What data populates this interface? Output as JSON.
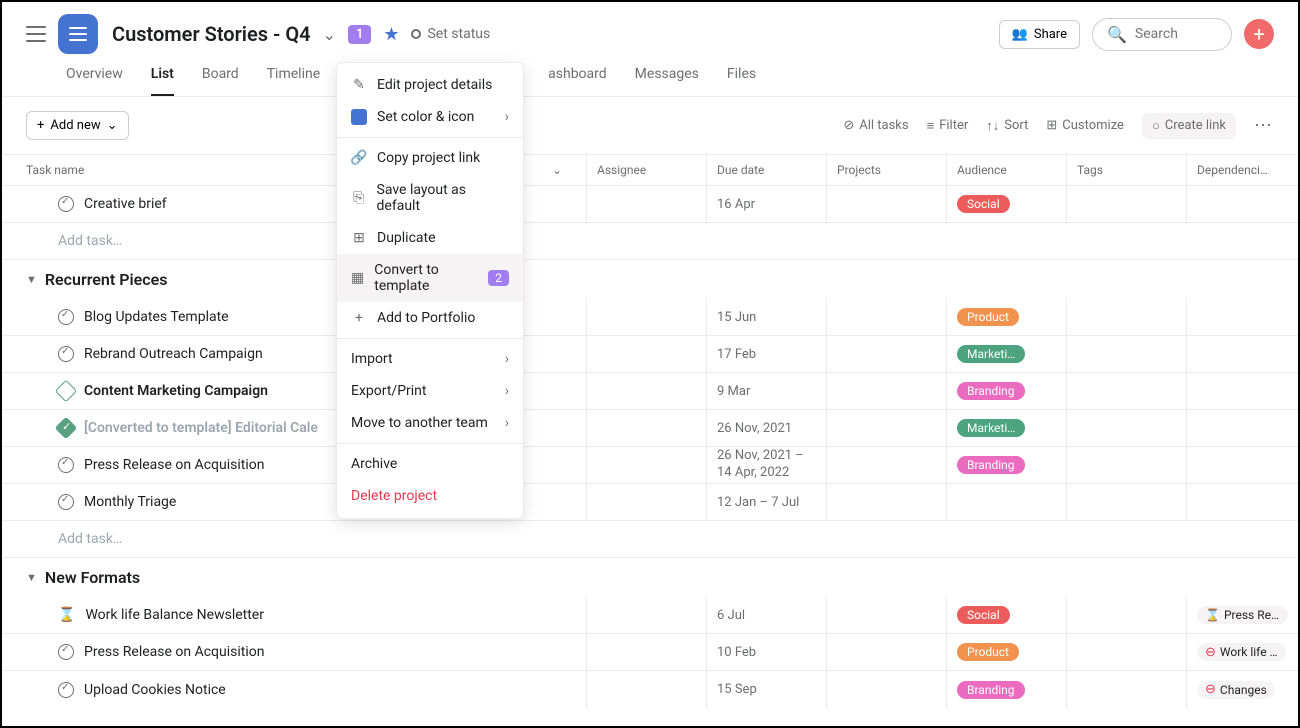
{
  "header": {
    "project_title": "Customer Stories - Q4",
    "badge": "1",
    "status_label": "Set status",
    "share_label": "Share",
    "search_placeholder": "Search"
  },
  "tabs": [
    "Overview",
    "List",
    "Board",
    "Timeline",
    "ashboard",
    "Messages",
    "Files"
  ],
  "active_tab": "List",
  "toolbar": {
    "add_new": "Add new",
    "all_tasks": "All tasks",
    "filter": "Filter",
    "sort": "Sort",
    "customize": "Customize",
    "create_link": "Create link"
  },
  "columns": {
    "task": "Task name",
    "assignee": "Assignee",
    "due": "Due date",
    "projects": "Projects",
    "audience": "Audience",
    "tags": "Tags",
    "dependencies": "Dependenci…"
  },
  "dropdown": {
    "edit": "Edit project details",
    "color": "Set color & icon",
    "copy": "Copy project link",
    "layout": "Save layout as default",
    "duplicate": "Duplicate",
    "convert": "Convert to template",
    "convert_badge": "2",
    "portfolio": "Add to Portfolio",
    "import": "Import",
    "export": "Export/Print",
    "move": "Move to another team",
    "archive": "Archive",
    "delete": "Delete project"
  },
  "sections": {
    "s0": {
      "rows": [
        {
          "name": "Creative brief",
          "due": "16 Apr",
          "audience": "Social",
          "audience_class": "social"
        }
      ],
      "add_task": "Add task…"
    },
    "s1": {
      "title": "Recurrent Pieces",
      "rows": [
        {
          "name": "Blog Updates Template",
          "due": "15 Jun",
          "audience": "Product",
          "audience_class": "product"
        },
        {
          "name": "Rebrand Outreach Campaign",
          "due": "17 Feb",
          "audience": "Marketi…",
          "audience_class": "marketing"
        },
        {
          "name": "Content Marketing Campaign",
          "bold": true,
          "diamond": true,
          "due": "9 Mar",
          "audience": "Branding",
          "audience_class": "branding"
        },
        {
          "name": "[Converted to template] Editorial Cale",
          "muted": true,
          "done": true,
          "due": "26 Nov, 2021",
          "audience": "Marketi…",
          "audience_class": "marketing"
        },
        {
          "name": "Press Release on Acquisition",
          "due_multi": "26 Nov, 2021 – 14 Apr, 2022",
          "audience": "Branding",
          "audience_class": "branding"
        },
        {
          "name": "Monthly Triage",
          "due": "12 Jan – 7 Jul"
        }
      ],
      "add_task": "Add task…"
    },
    "s2": {
      "title": "New Formats",
      "rows": [
        {
          "name": "Work life Balance Newsletter",
          "hourglass": true,
          "due": "6 Jul",
          "audience": "Social",
          "audience_class": "social",
          "dep": "Press Rele…",
          "dep_hourglass": true
        },
        {
          "name": "Press Release on Acquisition",
          "due": "10 Feb",
          "audience": "Product",
          "audience_class": "product",
          "dep": "Work life …",
          "dep_blocked": true
        },
        {
          "name": "Upload Cookies Notice",
          "due": "15 Sep",
          "audience": "Branding",
          "audience_class": "branding",
          "dep": "Changes",
          "dep_blocked": true
        }
      ]
    }
  }
}
